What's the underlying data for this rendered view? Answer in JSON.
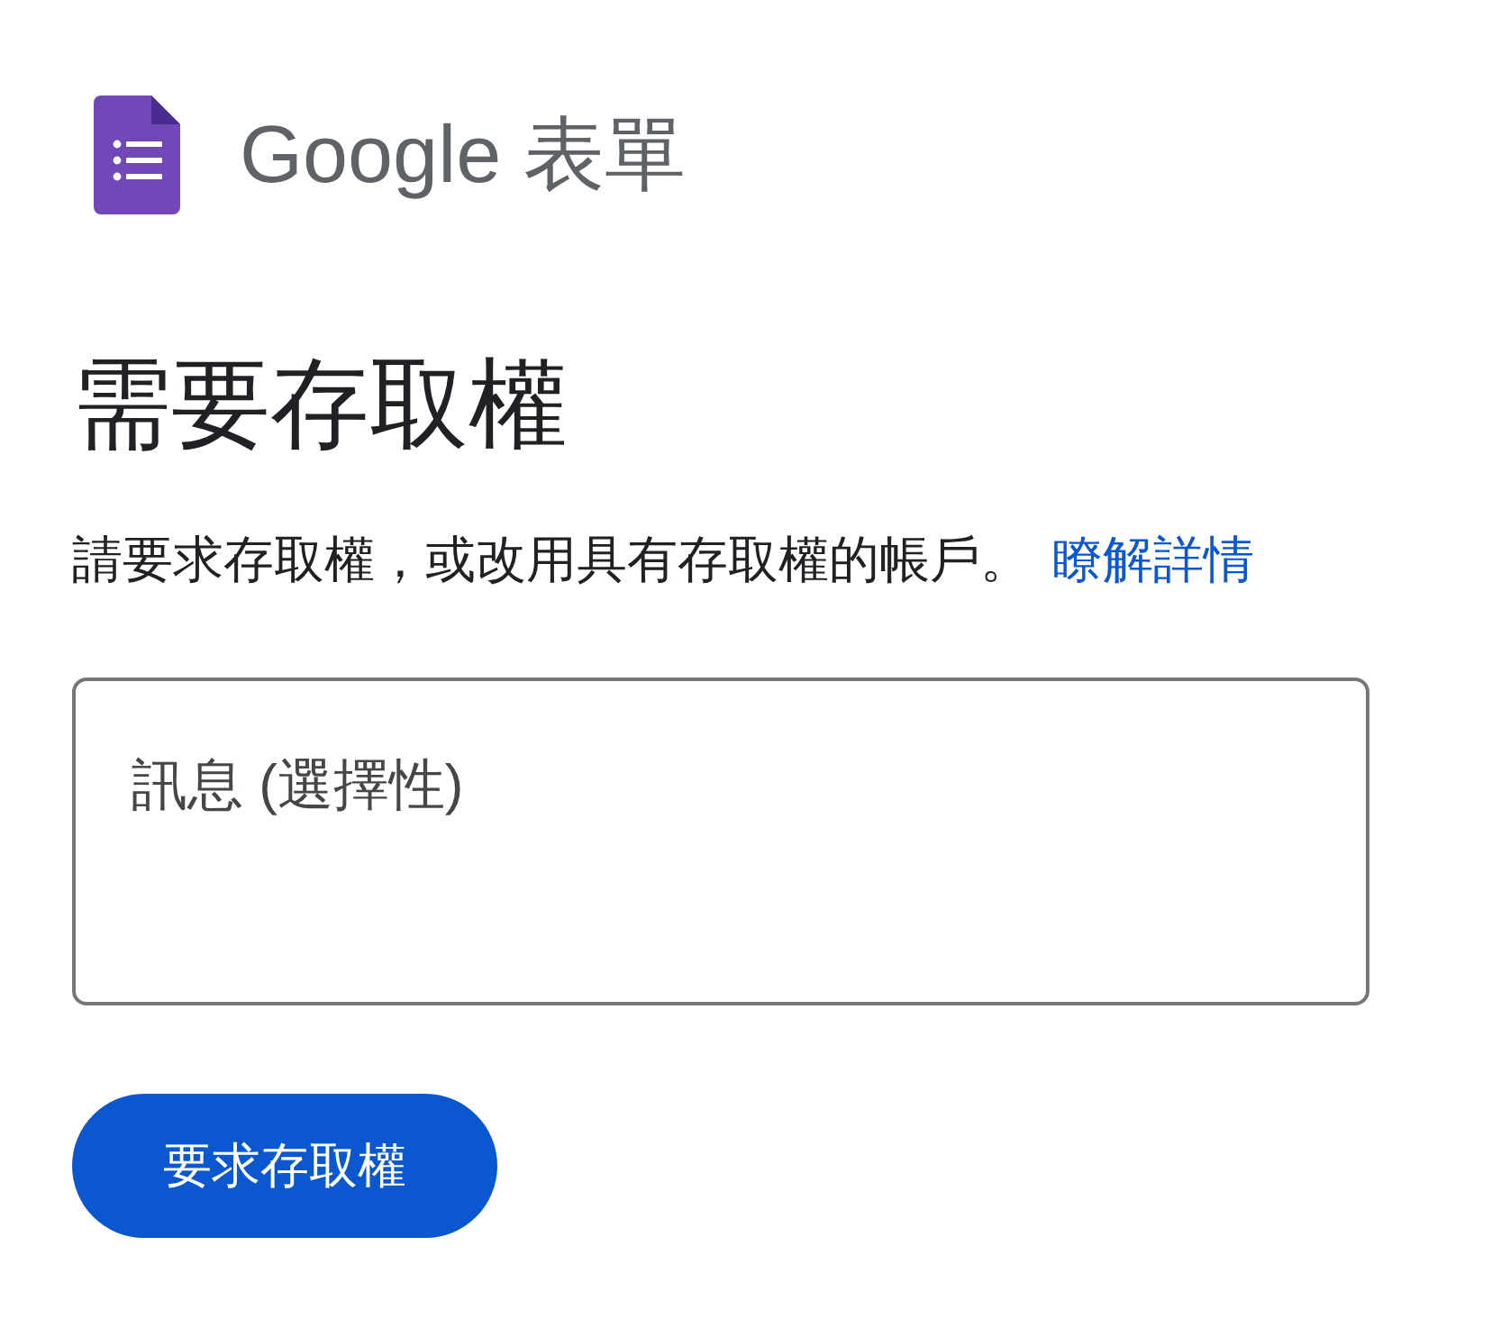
{
  "brand": {
    "logo_text": "Google 表單"
  },
  "heading": "需要存取權",
  "description": {
    "text": "請要求存取權，或改用具有存取權的帳戶。",
    "link": "瞭解詳情"
  },
  "message_field": {
    "placeholder": "訊息 (選擇性)"
  },
  "request_button": {
    "label": "要求存取權"
  }
}
